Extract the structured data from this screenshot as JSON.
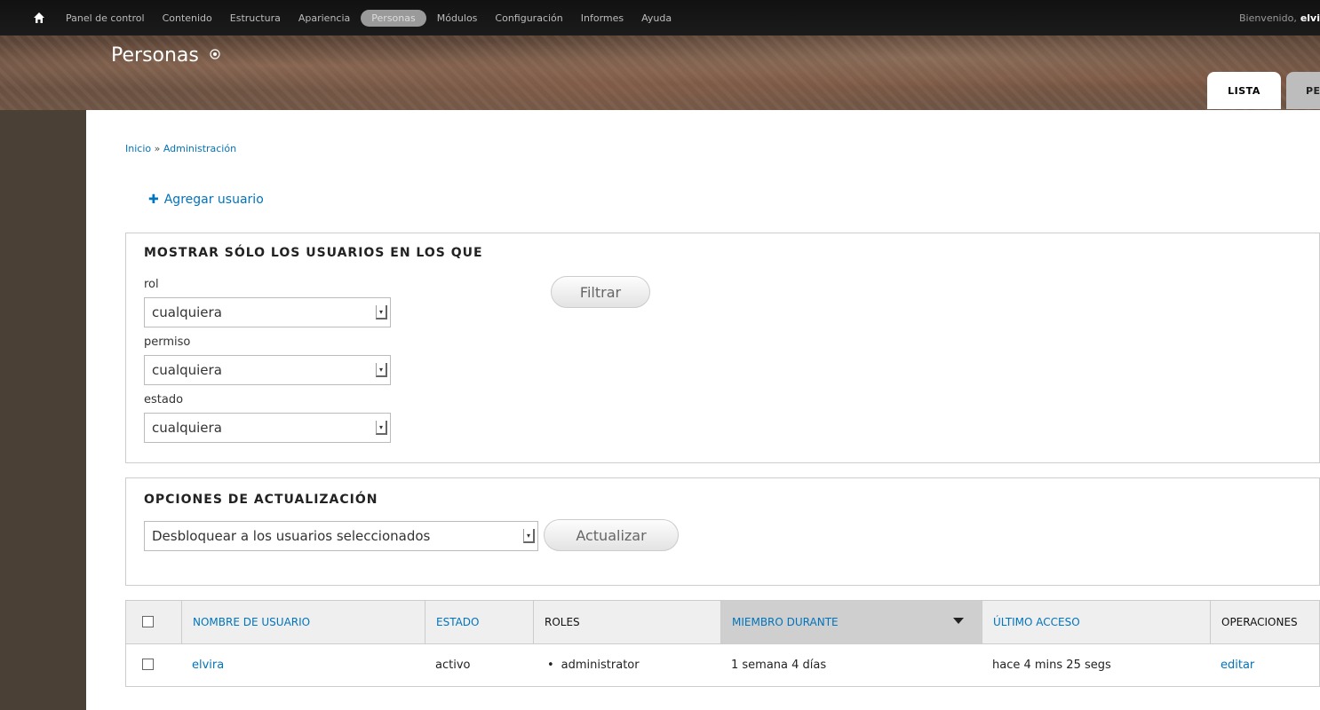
{
  "toolbar": {
    "home_icon": "home-icon",
    "items": [
      {
        "label": "Panel de control"
      },
      {
        "label": "Contenido"
      },
      {
        "label": "Estructura"
      },
      {
        "label": "Apariencia"
      },
      {
        "label": "Personas"
      },
      {
        "label": "Módulos"
      },
      {
        "label": "Configuración"
      },
      {
        "label": "Informes"
      },
      {
        "label": "Ayuda"
      }
    ],
    "active_item": "Personas",
    "welcome_prefix": "Bienvenido,",
    "welcome_user": "elvi"
  },
  "header": {
    "title": "Personas",
    "shortcut_icon": "add-shortcut-star-icon",
    "tabs": [
      {
        "label": "LISTA",
        "active": true
      },
      {
        "label": "PE",
        "active": false
      }
    ]
  },
  "breadcrumb": {
    "items": [
      "Inicio",
      "Administración"
    ],
    "separator": "»"
  },
  "actions": {
    "add_user_icon": "plus-icon",
    "add_user_label": "Agregar usuario"
  },
  "filter": {
    "legend": "MOSTRAR SÓLO LOS USUARIOS EN LOS QUE",
    "fields": [
      {
        "label": "rol",
        "value": "cualquiera"
      },
      {
        "label": "permiso",
        "value": "cualquiera"
      },
      {
        "label": "estado",
        "value": "cualquiera"
      }
    ],
    "button": "Filtrar"
  },
  "update": {
    "legend": "OPCIONES DE ACTUALIZACIÓN",
    "selected_option": "Desbloquear a los usuarios seleccionados",
    "button": "Actualizar"
  },
  "table": {
    "columns": [
      {
        "label": "NOMBRE DE USUARIO",
        "link": true
      },
      {
        "label": "ESTADO",
        "link": true
      },
      {
        "label": "ROLES",
        "link": false
      },
      {
        "label": "MIEMBRO DURANTE",
        "link": true,
        "sorted": true
      },
      {
        "label": "ÚLTIMO ACCESO",
        "link": true
      },
      {
        "label": "OPERACIONES",
        "link": false
      }
    ],
    "rows": [
      {
        "username": "elvira",
        "status": "activo",
        "role": "administrator",
        "member_for": "1 semana 4 días",
        "last_access": "hace 4 mins 25 segs",
        "operation": "editar"
      }
    ]
  },
  "colors": {
    "link": "#0074bd",
    "toolbar_bg": "#111111",
    "active_menu_bg": "#9a9a9a",
    "page_bg": "#4a4036"
  }
}
